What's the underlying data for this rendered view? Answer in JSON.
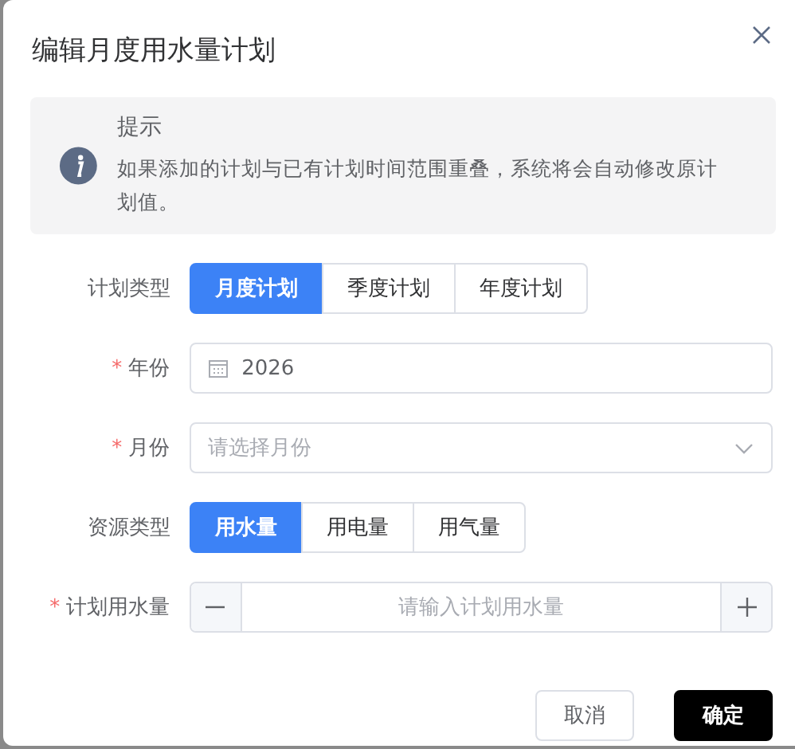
{
  "dialog": {
    "title": "编辑月度用水量计划"
  },
  "alert": {
    "title": "提示",
    "message": "如果添加的计划与已有计划时间范围重叠，系统将会自动修改原计划值。"
  },
  "form": [
    {
      "kind": "segmented",
      "label": "计划类型",
      "options": [
        {
          "label": "月度计划",
          "selected": true
        },
        {
          "label": "季度计划",
          "selected": false
        },
        {
          "label": "年度计划",
          "selected": false
        }
      ]
    },
    {
      "kind": "date",
      "required_mark": "*",
      "label": "年份",
      "value": "2026"
    },
    {
      "kind": "select",
      "required_mark": "*",
      "label": "月份",
      "placeholder": "请选择月份"
    },
    {
      "kind": "segmented",
      "label": "资源类型",
      "options": [
        {
          "label": "用水量",
          "selected": true
        },
        {
          "label": "用电量",
          "selected": false
        },
        {
          "label": "用气量",
          "selected": false
        }
      ]
    },
    {
      "kind": "number",
      "required_mark": "*",
      "label": "计划用水量",
      "placeholder": "请输入计划用水量"
    }
  ],
  "buttons": [
    {
      "label": "取消",
      "kind": "secondary"
    },
    {
      "label": "确定",
      "kind": "primary"
    }
  ]
}
